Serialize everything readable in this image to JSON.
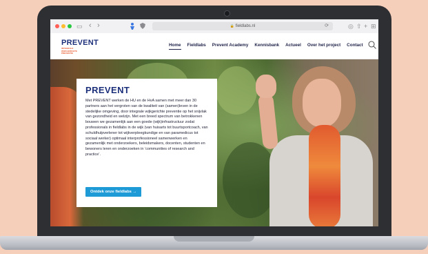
{
  "browser": {
    "url": "fieldlabs.nl",
    "back_glyph": "‹",
    "forward_glyph": "›",
    "sidebar_glyph": "▭",
    "reload_glyph": "⟳",
    "share_glyph": "⇧",
    "new_tab_glyph": "+",
    "tabs_glyph": "⊞"
  },
  "logo": {
    "main": "PREVENT",
    "sub": "INTEGRALE WIJKGERICHTE PREVENTIE"
  },
  "nav": {
    "items": [
      {
        "label": "Home",
        "active": true
      },
      {
        "label": "Fieldlabs",
        "active": false
      },
      {
        "label": "Prevent Academy",
        "active": false
      },
      {
        "label": "Kennisbank",
        "active": false
      },
      {
        "label": "Actueel",
        "active": false
      },
      {
        "label": "Over het project",
        "active": false
      },
      {
        "label": "Contact",
        "active": false
      }
    ],
    "search_icon": "search-icon"
  },
  "hero": {
    "title": "PREVENT",
    "body": "Met PREVENT werken de HU en de HvA samen met meer dan 30 partners aan het vergroten van de kwaliteit van (samen)leven in de stedelijke omgeving, door integrale wijkgerichte preventie op het snijvlak van gezondheid en welzijn. Met een breed spectrum van betrokkenen bouwen we gezamenlijk aan een goede (wijk)infrastructuur zodat professionals in fieldlabs in de wijk (van huisarts tot buurtsportcoach, van schuldhulpverlener tot wijkverpleegkundige en van paramedicus tot sociaal werker) optimaal interprofessioneel samenwerken en gezamenlijk met onderzoekers, beleidsmakers, docenten, studenten en bewoners leren en onderzoeken in ‘communities of research and practice’.",
    "cta_label": "Ontdek onze fieldlabs →"
  },
  "colors": {
    "brand_navy": "#1c2f7a",
    "brand_orange": "#e8562a",
    "cta_blue": "#1e9ad6",
    "backdrop": "#f6cfbb"
  }
}
